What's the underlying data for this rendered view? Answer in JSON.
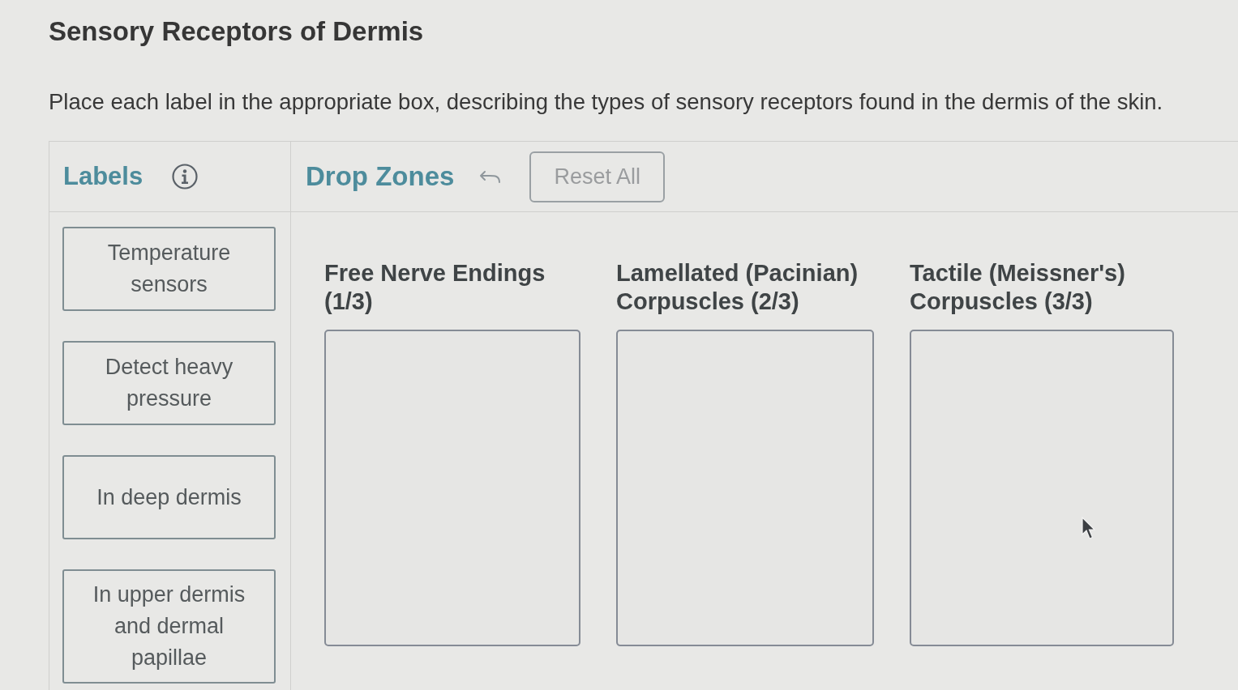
{
  "title": "Sensory Receptors of Dermis",
  "instructions": "Place each label in the appropriate box, describing the types of sensory receptors found in the dermis of the skin.",
  "labels_panel": {
    "heading": "Labels",
    "items": [
      {
        "text": "Temperature sensors"
      },
      {
        "text": "Detect heavy pressure"
      },
      {
        "text": "In deep dermis"
      },
      {
        "text": "In upper dermis and dermal papillae"
      }
    ]
  },
  "drop_zones_panel": {
    "heading": "Drop Zones",
    "reset_button": "Reset All",
    "zones": [
      {
        "title": "Free Nerve Endings (1/3)"
      },
      {
        "title": "Lamellated (Pacinian) Corpuscles (2/3)"
      },
      {
        "title": "Tactile (Meissner's) Corpuscles (3/3)"
      }
    ]
  }
}
